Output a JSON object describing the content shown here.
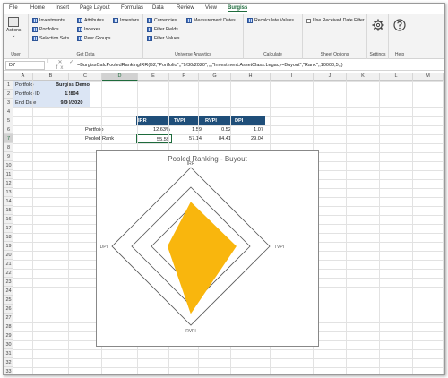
{
  "ribbon_tabs": [
    "File",
    "Home",
    "Insert",
    "Page Layout",
    "Formulas",
    "Data",
    "Review",
    "View",
    "Burgiss"
  ],
  "active_tab": "Burgiss",
  "groups": {
    "user": {
      "label": "User",
      "actions_label": "Actions"
    },
    "get_data": {
      "label": "Get Data",
      "items": [
        "Investments",
        "Portfolios",
        "Selection Sets",
        "Attributes",
        "Indexes",
        "Peer Groups",
        "Investors"
      ]
    },
    "universe_analytics": {
      "label": "Universe Analytics",
      "items": [
        "Currencies",
        "Filter Fields",
        "Filter Values",
        "Measurement Dates"
      ]
    },
    "calculate": {
      "label": "Calculate",
      "items": [
        "Recalculate Values"
      ]
    },
    "sheet_options": {
      "label": "Sheet Options",
      "items": [
        "Use Received Date Filter"
      ]
    },
    "settings": {
      "label": "Settings"
    },
    "help": {
      "label": "Help"
    }
  },
  "formula_bar": {
    "name_box": "D7",
    "icons": "⋮ ✕ ✓ fx",
    "formula": "=BurgissCalcPooledRankingIRR(B2,\"Portfolio\",,\"9/30/2020\",,,,\"Investment.AssetClass.Legacy=Buyout\",\"Rank\",,10000,5,,)"
  },
  "columns": [
    "A",
    "B",
    "C",
    "D",
    "E",
    "F",
    "G",
    "H",
    "I",
    "J",
    "K",
    "L",
    "M"
  ],
  "selected_column": "D",
  "rows": [
    "1",
    "2",
    "3",
    "4",
    "5",
    "6",
    "7",
    "8",
    "9",
    "10",
    "11",
    "12",
    "13",
    "14",
    "15",
    "16",
    "17",
    "18",
    "19",
    "20",
    "21",
    "22",
    "23",
    "24",
    "25",
    "26",
    "27",
    "28",
    "29",
    "30",
    "31",
    "32",
    "33"
  ],
  "selected_row": "7",
  "info_table": [
    {
      "label": "Portfolio",
      "value": "Burgiss Demo"
    },
    {
      "label": "Portfolio ID",
      "value": "12804"
    },
    {
      "label": "End Date",
      "value": "9/30/2020"
    }
  ],
  "results_table": {
    "headers": [
      "IRR",
      "TVPI",
      "RVPI",
      "DPI"
    ],
    "rows": [
      {
        "label": "Portfolio",
        "values": [
          "12.63%",
          "1.59",
          "0.52",
          "1.07"
        ]
      },
      {
        "label": "Pooled Rank",
        "values": [
          "55.59",
          "57.14",
          "84.41",
          "29.04"
        ]
      }
    ]
  },
  "chart_data": {
    "type": "radar",
    "title": "Pooled Ranking - Buyout",
    "axes": [
      "IRR",
      "TVPI",
      "RVPI",
      "DPI"
    ],
    "values": [
      55.59,
      57.14,
      84.41,
      29.04
    ],
    "rmax": 100,
    "rings": [
      25,
      50,
      75,
      100
    ],
    "fill_color": "#F9B60D",
    "grid_color": "#595959"
  },
  "colors": {
    "accent_green": "#1e6b3c",
    "header_navy": "#1f4e79",
    "light_blue": "#dbe5f4"
  }
}
